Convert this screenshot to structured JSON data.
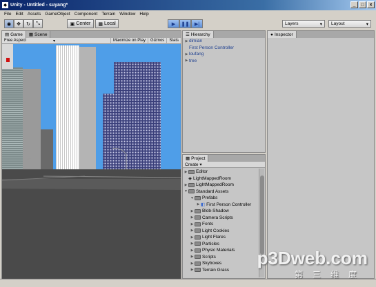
{
  "window": {
    "title": "Unity - Untitled - suyang*",
    "controls": [
      "_",
      "□",
      "×"
    ]
  },
  "menubar": [
    "File",
    "Edit",
    "Assets",
    "GameObject",
    "Component",
    "Terrain",
    "Window",
    "Help"
  ],
  "toolbar": {
    "center_label": "Center",
    "local_label": "Local",
    "layers_label": "Layers",
    "layout_label": "Layout"
  },
  "game_panel": {
    "tabs": [
      "Game",
      "Scene"
    ],
    "aspect": "Free Aspect",
    "options": [
      "Maximize on Play",
      "Gizmos",
      "Stats"
    ]
  },
  "hierarchy": {
    "tab": "Hierarchy",
    "items": [
      "dimian",
      "First Person Controller",
      "loufang",
      "tree"
    ]
  },
  "inspector": {
    "tab": "Inspector"
  },
  "project": {
    "tab": "Project",
    "create_label": "Create",
    "items": [
      {
        "label": "Editor",
        "indent": 0,
        "arrow": "▶",
        "type": "folder"
      },
      {
        "label": "LightMappedRoom",
        "indent": 0,
        "arrow": "",
        "type": "scene"
      },
      {
        "label": "LightMappedRoom",
        "indent": 0,
        "arrow": "▶",
        "type": "folder"
      },
      {
        "label": "Standard Assets",
        "indent": 0,
        "arrow": "▼",
        "type": "folder"
      },
      {
        "label": "Prefabs",
        "indent": 1,
        "arrow": "▼",
        "type": "folder"
      },
      {
        "label": "First Person Controller",
        "indent": 2,
        "arrow": "▶",
        "type": "prefab"
      },
      {
        "label": "Blob-Shadow",
        "indent": 1,
        "arrow": "▶",
        "type": "folder"
      },
      {
        "label": "Camera Scripts",
        "indent": 1,
        "arrow": "▶",
        "type": "folder"
      },
      {
        "label": "Fonts",
        "indent": 1,
        "arrow": "▶",
        "type": "folder"
      },
      {
        "label": "Light Cookies",
        "indent": 1,
        "arrow": "▶",
        "type": "folder"
      },
      {
        "label": "Light Flares",
        "indent": 1,
        "arrow": "▶",
        "type": "folder"
      },
      {
        "label": "Particles",
        "indent": 1,
        "arrow": "▶",
        "type": "folder"
      },
      {
        "label": "Physic Materials",
        "indent": 1,
        "arrow": "▶",
        "type": "folder"
      },
      {
        "label": "Scripts",
        "indent": 1,
        "arrow": "▶",
        "type": "folder"
      },
      {
        "label": "Skyboxes",
        "indent": 1,
        "arrow": "▶",
        "type": "folder"
      },
      {
        "label": "Terrain Grass",
        "indent": 1,
        "arrow": "▶",
        "type": "folder"
      }
    ]
  },
  "watermark": {
    "main": "p3Dweb.com",
    "sub": "第三维度"
  },
  "colors": {
    "sky": "#4f9ee8",
    "ground": "#4a4a4a",
    "title_bar": "#0a246a",
    "play_active": "#5e8fd8"
  }
}
